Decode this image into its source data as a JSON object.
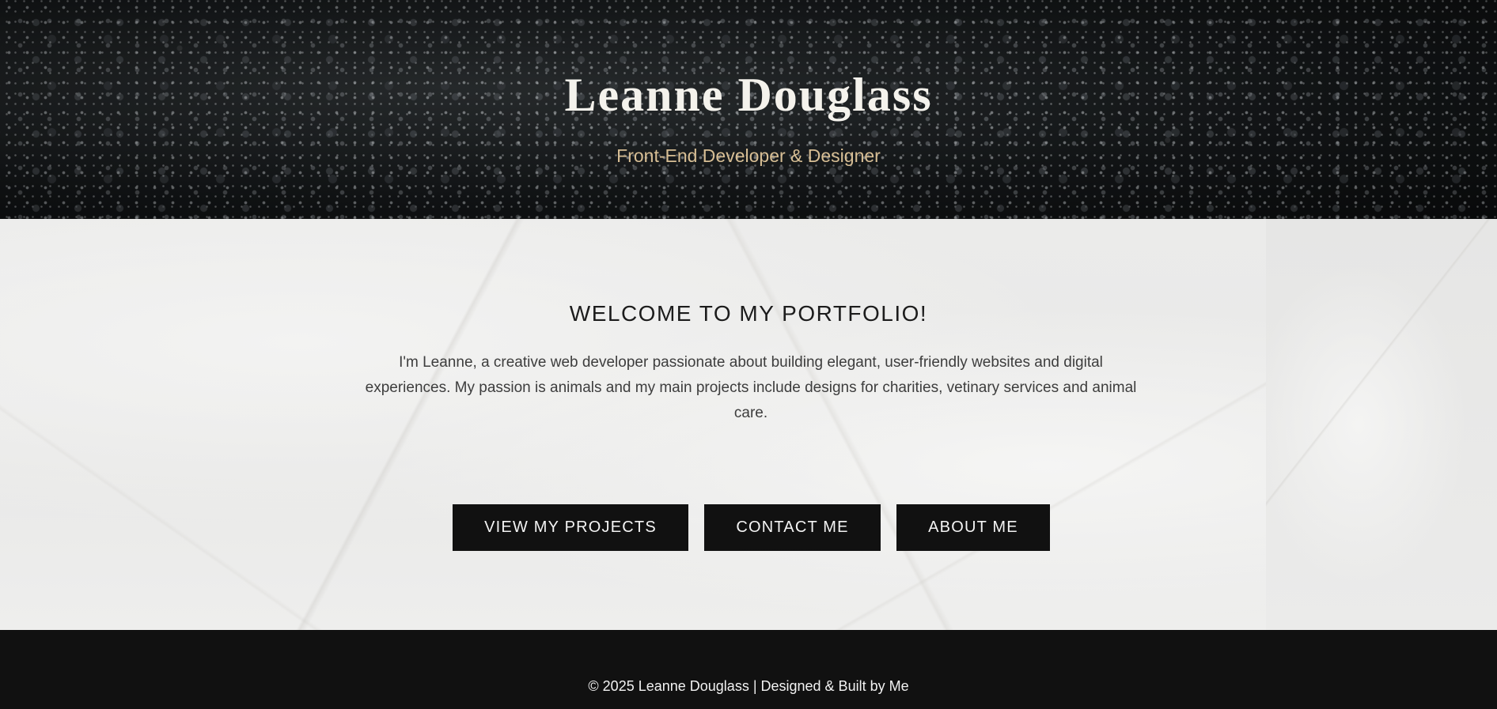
{
  "header": {
    "name": "Leanne Douglass",
    "tagline": "Front-End Developer & Designer"
  },
  "main": {
    "welcome_title": "WELCOME TO MY PORTFOLIO!",
    "intro_text": "I'm Leanne, a creative web developer passionate about building elegant, user-friendly websites and digital experiences. My passion is animals and my main projects include designs for charities, vetinary services and animal care.",
    "buttons": [
      {
        "label": "VIEW MY PROJECTS"
      },
      {
        "label": "CONTACT ME"
      },
      {
        "label": "ABOUT ME"
      }
    ]
  },
  "footer": {
    "text": "© 2025 Leanne Douglass | Designed & Built by Me"
  },
  "colors": {
    "hero_background": "#15181a",
    "tagline": "#d8bf95",
    "button_background": "#111111",
    "footer_background": "#111111"
  }
}
